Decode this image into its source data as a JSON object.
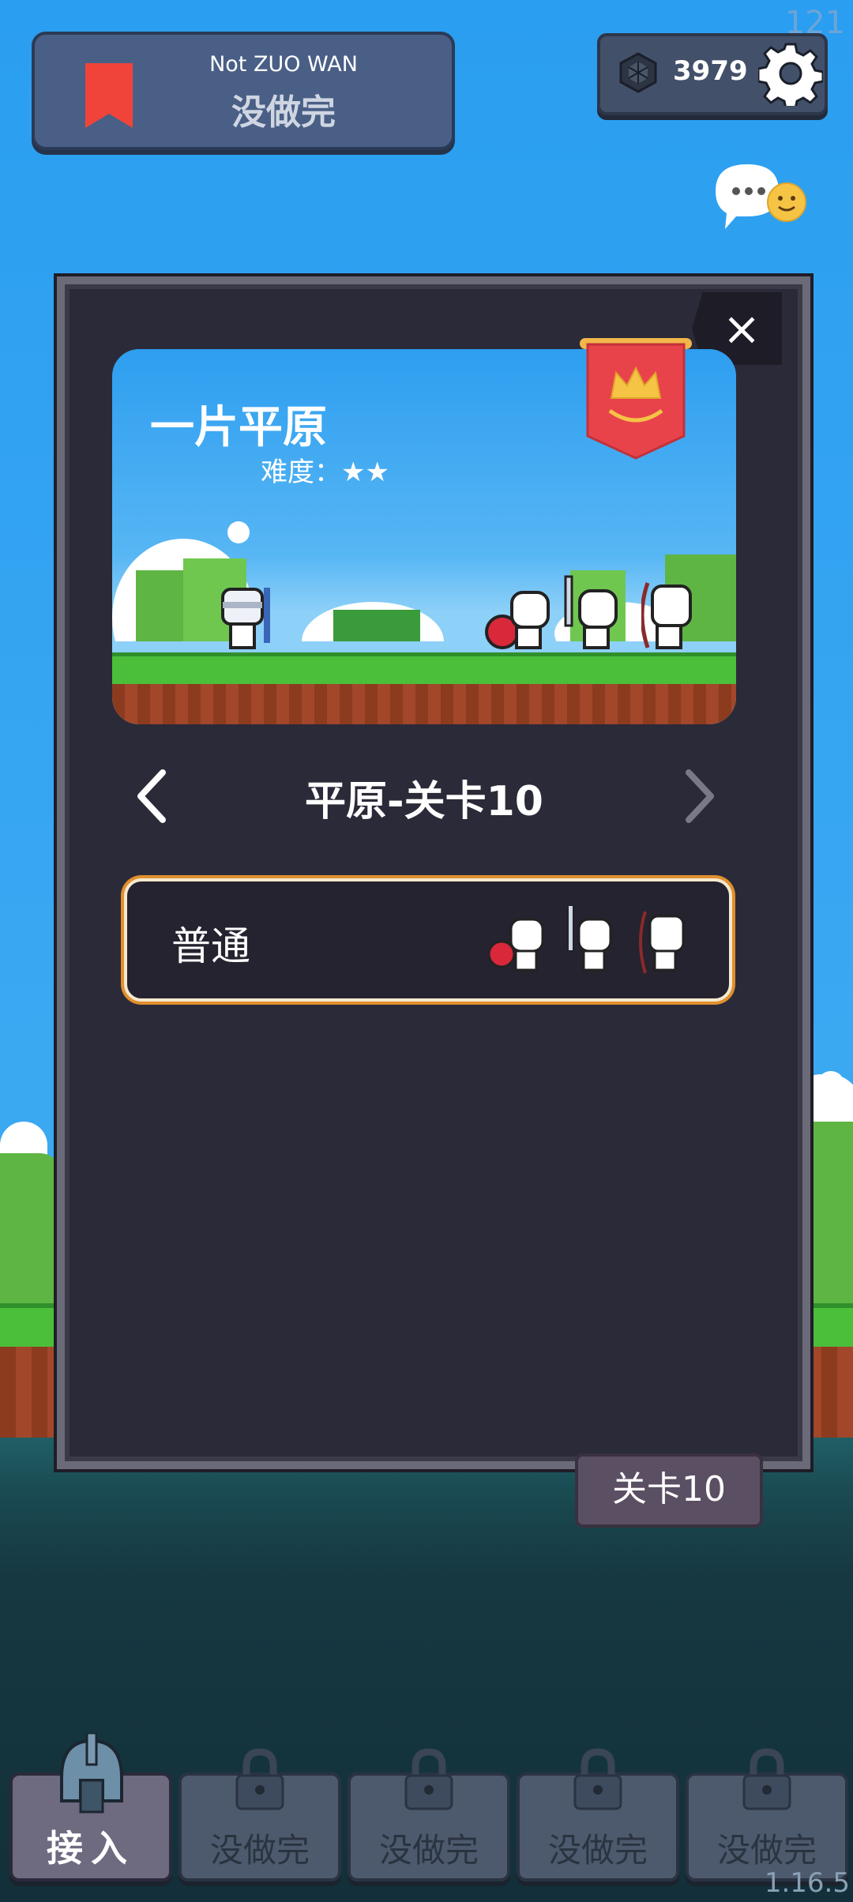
{
  "topbar": {
    "title_en": "Not ZUO WAN",
    "title_cn": "没做完",
    "gem_count": "3979",
    "corner_number": "121"
  },
  "modal": {
    "level_name": "一片平原",
    "difficulty_label": "难度：",
    "difficulty_stars": "★★",
    "nav_title": "平原-关卡10",
    "mode_label": "普通",
    "close_label": "×"
  },
  "level_badge": "关卡10",
  "slots": [
    {
      "label": "接入",
      "state": "active"
    },
    {
      "label": "没做完",
      "state": "locked"
    },
    {
      "label": "没做完",
      "state": "locked"
    },
    {
      "label": "没做完",
      "state": "locked"
    },
    {
      "label": "没做完",
      "state": "locked"
    }
  ],
  "version": "1.16.5",
  "colors": {
    "sky": "#2a9ef0",
    "panel": "#2b2a38",
    "mode_border": "#e0902e",
    "banner_red": "#e8434a",
    "title_card": "#4a5f86"
  },
  "icons": {
    "bookmark": "bookmark-icon",
    "gem": "gem-icon",
    "settings": "gear-icon",
    "chat": "chat-bubble-icon",
    "close": "close-icon",
    "prev": "chevron-left-icon",
    "next": "chevron-right-icon",
    "lock": "lock-icon",
    "helmet": "helmet-icon",
    "banner": "crown-banner-icon"
  }
}
